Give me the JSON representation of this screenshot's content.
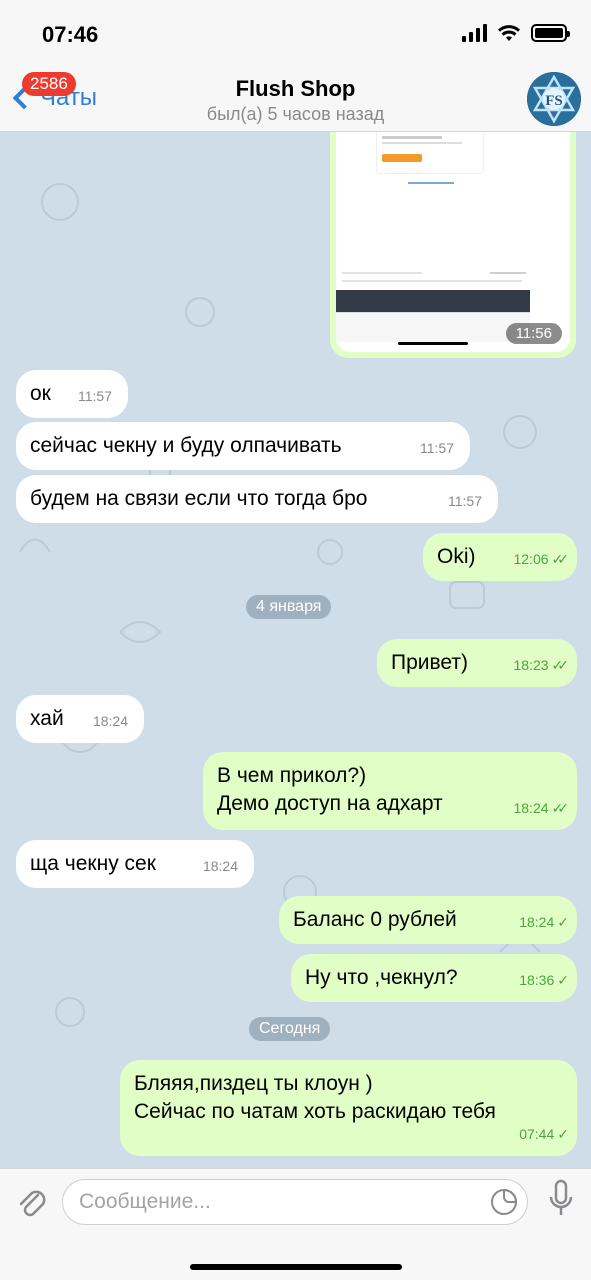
{
  "status_bar": {
    "time": "07:46"
  },
  "header": {
    "back_label": "Чаты",
    "unread_count": "2586",
    "title": "Flush Shop",
    "subtitle": "был(а) 5 часов назад",
    "avatar_text": "FS"
  },
  "image_message": {
    "time": "11:56"
  },
  "messages": [
    {
      "text": "ок",
      "time": "11:57"
    },
    {
      "text": "сейчас чекну и буду олпачивать",
      "time": "11:57"
    },
    {
      "text": "будем на связи если что тогда бро",
      "time": "11:57"
    },
    {
      "text": "Oki)",
      "time": "12:06"
    },
    {
      "text": "Привет)",
      "time": "18:23"
    },
    {
      "text": "хай",
      "time": "18:24"
    },
    {
      "line1": "В чем прикол?)",
      "line2": "Демо доступ на адхарт",
      "time": "18:24"
    },
    {
      "text": "ща чекну сек",
      "time": "18:24"
    },
    {
      "text": "Баланс 0 рублей",
      "time": "18:24"
    },
    {
      "text": "Ну что ,чекнул?",
      "time": "18:36"
    },
    {
      "line1": "Бляяя,пиздец ты клоун )",
      "line2": "Сейчас по чатам хоть раскидаю тебя",
      "time": "07:44"
    }
  ],
  "date_separators": [
    "4 января",
    "Сегодня"
  ],
  "composer": {
    "placeholder": "Сообщение..."
  },
  "colors": {
    "accent": "#2f7ed8",
    "outgoing_bubble": "#e1fec6",
    "incoming_bubble": "#ffffff",
    "chat_background": "#cfdde8",
    "badge": "#ec3b2f",
    "read_check": "#4ca43f"
  },
  "icons": [
    "back-chevron-icon",
    "signal-icon",
    "wifi-icon",
    "battery-icon",
    "attach-icon",
    "sticker-icon",
    "microphone-icon"
  ]
}
